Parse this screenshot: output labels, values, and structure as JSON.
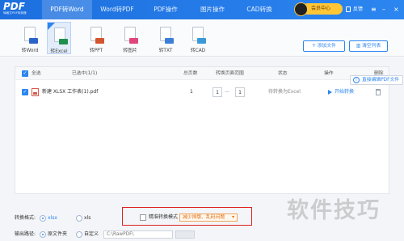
{
  "app": {
    "logo_text": "PDF",
    "logo_sub": "嗨格式PDF转换器",
    "tabs": [
      {
        "label": "PDF转Word"
      },
      {
        "label": "Word转PDF"
      },
      {
        "label": "PDF操作"
      },
      {
        "label": "图片操作"
      },
      {
        "label": "CAD转换"
      }
    ],
    "member_label": "会员中心",
    "feedback_label": "反馈"
  },
  "toolbar": {
    "tools": [
      {
        "label": "转Word",
        "icon": "word-doc-icon",
        "color": "#2b63c9"
      },
      {
        "label": "转Excel",
        "icon": "excel-doc-icon",
        "color": "#1f8f4d"
      },
      {
        "label": "转PPT",
        "icon": "ppt-doc-icon",
        "color": "#d2552f"
      },
      {
        "label": "转图片",
        "icon": "image-doc-icon",
        "color": "#e0457b"
      },
      {
        "label": "转TXT",
        "icon": "txt-doc-icon",
        "color": "#3d7fd8"
      },
      {
        "label": "转CAD",
        "icon": "cad-doc-icon",
        "color": "#3a9ad9"
      }
    ],
    "add_file_label": "添加文件",
    "clear_list_label": "清空列表"
  },
  "table": {
    "headers": {
      "select_all": "全选",
      "selected": "已选中(1/1)",
      "total_pages": "总页数",
      "page_range": "转换页面范围",
      "status": "状态",
      "action": "操作",
      "delete": "删除"
    },
    "rows": [
      {
        "filename": "新建 XLSX 工作表(1).pdf",
        "total_pages": "1",
        "range_from": "1",
        "range_to": "1",
        "status": "待转换为Excel",
        "action": "开始转换"
      }
    ]
  },
  "tooltip": {
    "label": "直接编辑PDF文件"
  },
  "bottom": {
    "format_label": "转换格式:",
    "format_options": [
      "xlsx",
      "xls"
    ],
    "precise_mode_label": "精准转换模式",
    "precise_mode_value": "减少排版、乱码问题",
    "output_label": "输出路径:",
    "output_options": [
      "原文件夹",
      "自定义"
    ],
    "output_path": "C:\\RawPDF\\"
  },
  "watermark": "软件技巧"
}
